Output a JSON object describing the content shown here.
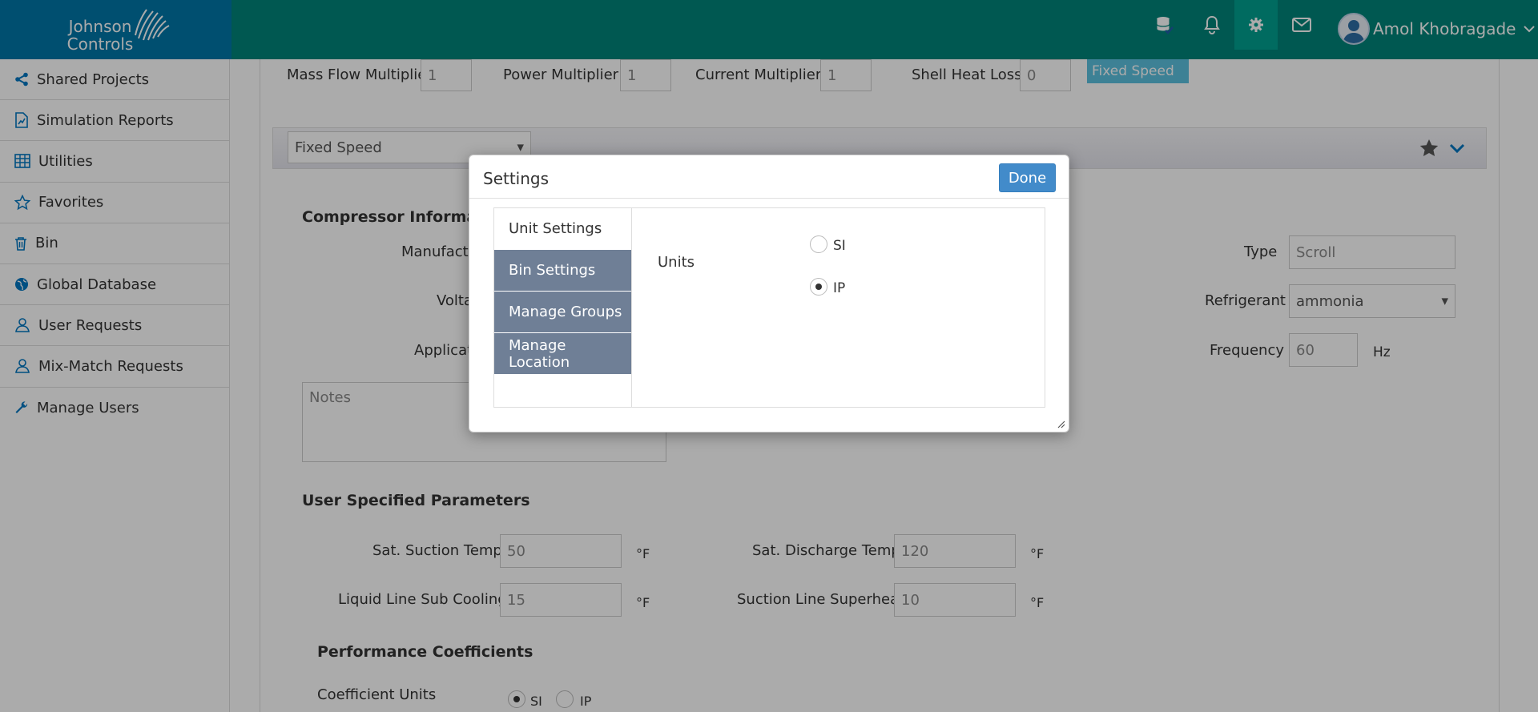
{
  "header": {
    "brand_line1": "Johnson",
    "brand_line2": "Controls",
    "icons": [
      "database-icon",
      "bell-icon",
      "gear-icon",
      "envelope-icon"
    ],
    "user_name": "Amol Khobragade",
    "colors": {
      "header_bg": "#008479",
      "brand_bg": "#0076a8"
    }
  },
  "sidebar": {
    "items": [
      {
        "label": "Shared Projects",
        "icon": "share-icon"
      },
      {
        "label": "Simulation Reports",
        "icon": "report-icon"
      },
      {
        "label": "Utilities",
        "icon": "grid-icon"
      },
      {
        "label": "Favorites",
        "icon": "star-icon"
      },
      {
        "label": "Bin",
        "icon": "trash-icon"
      },
      {
        "label": "Global Database",
        "icon": "globe-icon"
      },
      {
        "label": "User Requests",
        "icon": "user-icon"
      },
      {
        "label": "Mix-Match Requests",
        "icon": "user-icon"
      },
      {
        "label": "Manage Users",
        "icon": "wrench-icon"
      }
    ]
  },
  "main": {
    "multipliers": {
      "mass_flow_label": "Mass Flow Multiplier",
      "mass_flow_value": "1",
      "power_label": "Power Multiplier",
      "power_value": "1",
      "current_label": "Current Multiplier",
      "current_value": "1",
      "shell_heat_label": "Shell Heat Loss",
      "shell_heat_value": "0",
      "speed_tag": "Fixed Speed"
    },
    "speed_select": "Fixed Speed",
    "compressor": {
      "heading": "Compressor Informatio",
      "manufacturer_label": "Manufactu",
      "voltage_label": "Volta",
      "application_label": "Applicati",
      "notes_placeholder": "Notes",
      "type_label": "Type",
      "type_value": "Scroll",
      "refrigerant_label": "Refrigerant",
      "refrigerant_value": "ammonia",
      "frequency_label": "Frequency",
      "frequency_value": "60",
      "frequency_unit": "Hz"
    },
    "user_params": {
      "heading": "User Specified Parameters",
      "sat_suction_label": "Sat. Suction Temp",
      "sat_suction_value": "50",
      "sat_discharge_label": "Sat. Discharge Temp",
      "sat_discharge_value": "120",
      "liquid_line_label": "Liquid Line Sub Cooling",
      "liquid_line_value": "15",
      "suction_superheat_label": "Suction Line Superheat",
      "suction_superheat_value": "10",
      "temp_unit": "°F"
    },
    "performance": {
      "heading": "Performance Coefficients",
      "coeff_units_label": "Coefficient Units",
      "si_label": "SI",
      "ip_label": "IP",
      "selected": "SI"
    }
  },
  "dialog": {
    "title": "Settings",
    "done_label": "Done",
    "tabs": [
      "Unit Settings",
      "Bin Settings",
      "Manage Groups",
      "Manage Location"
    ],
    "active_tab": "Unit Settings",
    "units_label": "Units",
    "si_label": "SI",
    "ip_label": "IP",
    "selected_unit": "IP",
    "tab_color": "#6f7f96"
  }
}
